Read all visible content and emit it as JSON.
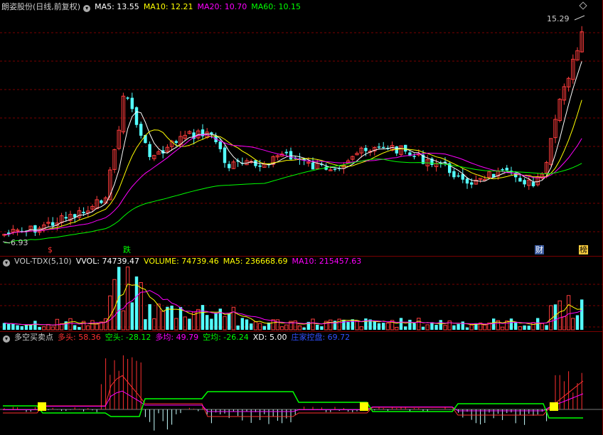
{
  "price_panel": {
    "title": "朗姿股份(日线,前复权)",
    "ma_labels": [
      {
        "text": "MA5: 13.55",
        "color": "#ffffff"
      },
      {
        "text": "MA10: 12.21",
        "color": "#ffff00"
      },
      {
        "text": "MA20: 10.70",
        "color": "#ff00ff"
      },
      {
        "text": "MA60: 10.15",
        "color": "#00ff00"
      }
    ],
    "high_label": "15.29",
    "low_label": "6.93",
    "tags": {
      "s": "$",
      "die": "跌",
      "cai": "财",
      "bang": "榜"
    }
  },
  "vol_panel": {
    "title": "VOL-TDX(5,10)",
    "labels": [
      {
        "text": "VVOL: 74739.47",
        "color": "#ffffff"
      },
      {
        "text": "VOLUME: 74739.46",
        "color": "#ffff00"
      },
      {
        "text": "MA5: 236668.69",
        "color": "#ffff00"
      },
      {
        "text": "MA10: 215457.63",
        "color": "#ff00ff"
      }
    ]
  },
  "ind_panel": {
    "title": "多空买卖点",
    "labels": [
      {
        "text": "多头: 58.36",
        "color": "#ff3030"
      },
      {
        "text": "空头: -28.12",
        "color": "#00ff00"
      },
      {
        "text": "多均: 49.79",
        "color": "#ff00ff"
      },
      {
        "text": "空均: -26.24",
        "color": "#00ff00"
      },
      {
        "text": "XD: 5.00",
        "color": "#ffffff"
      },
      {
        "text": "庄家控盘: 69.72",
        "color": "#3050ff"
      }
    ]
  },
  "colors": {
    "up": "#ff3c3c",
    "down": "#54ffff",
    "grid": "#7a0000",
    "ma5": "#ffffff",
    "ma10": "#ffff00",
    "ma20": "#ff00ff",
    "ma60": "#00ff00"
  }
}
